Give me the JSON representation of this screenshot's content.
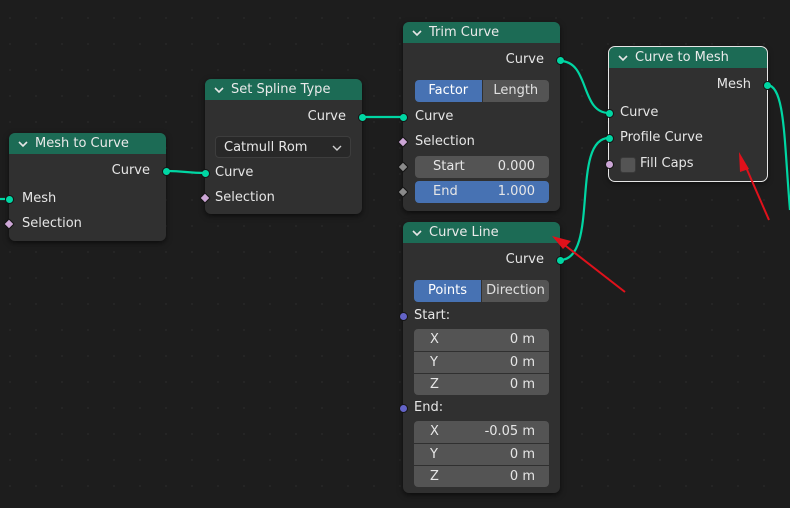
{
  "nodes": {
    "mesh_to_curve": {
      "title": "Mesh to Curve",
      "outputs": [
        "Curve"
      ],
      "inputs": [
        "Mesh",
        "Selection"
      ]
    },
    "set_spline_type": {
      "title": "Set Spline Type",
      "outputs": [
        "Curve"
      ],
      "dropdown_value": "Catmull Rom",
      "inputs": [
        "Curve",
        "Selection"
      ]
    },
    "trim_curve": {
      "title": "Trim Curve",
      "outputs": [
        "Curve"
      ],
      "mode_options": [
        "Factor",
        "Length"
      ],
      "mode_selected": "Factor",
      "inputs": [
        "Curve",
        "Selection"
      ],
      "start": {
        "label": "Start",
        "value": "0.000"
      },
      "end": {
        "label": "End",
        "value": "1.000"
      }
    },
    "curve_line": {
      "title": "Curve Line",
      "outputs": [
        "Curve"
      ],
      "mode_options": [
        "Points",
        "Direction"
      ],
      "mode_selected": "Points",
      "start_label": "Start:",
      "start_xyz": [
        {
          "axis": "X",
          "value": "0 m"
        },
        {
          "axis": "Y",
          "value": "0 m"
        },
        {
          "axis": "Z",
          "value": "0 m"
        }
      ],
      "end_label": "End:",
      "end_xyz": [
        {
          "axis": "X",
          "value": "-0.05 m"
        },
        {
          "axis": "Y",
          "value": "0 m"
        },
        {
          "axis": "Z",
          "value": "0 m"
        }
      ]
    },
    "curve_to_mesh": {
      "title": "Curve to Mesh",
      "outputs": [
        "Mesh"
      ],
      "inputs": [
        "Curve",
        "Profile Curve"
      ],
      "fill_caps_label": "Fill Caps",
      "fill_caps_checked": false
    }
  },
  "colors": {
    "background": "#1d1d1d",
    "node_body": "#303030",
    "node_header": "#1c6b55",
    "geometry_socket": "#00d6a3",
    "vector_socket": "#6363c7",
    "field_socket": "#cca6d6",
    "selected_button": "#4772b3",
    "annotation_arrow": "#e0111b"
  }
}
